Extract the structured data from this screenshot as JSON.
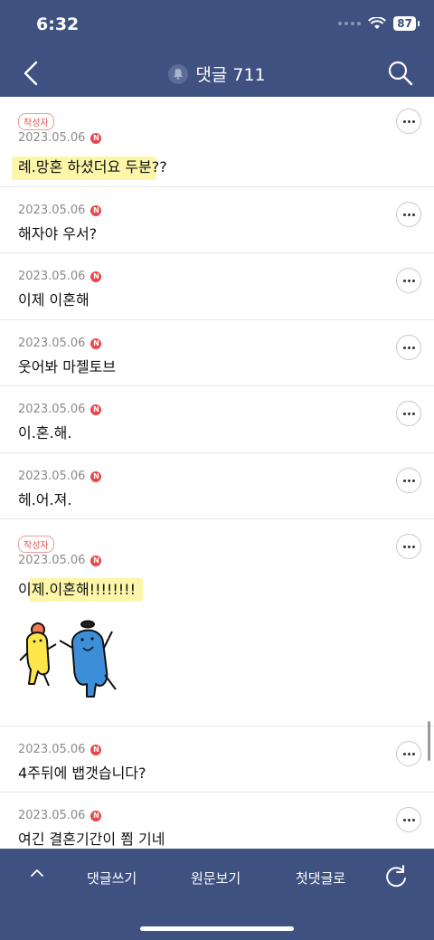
{
  "status": {
    "time": "6:32",
    "battery": "87"
  },
  "header": {
    "title": "댓글 711"
  },
  "comments": [
    {
      "author_badge": "작성자",
      "date": "2023.05.06",
      "text": "례.망혼 하셨더요 두분??"
    },
    {
      "date": "2023.05.06",
      "text": "해자야 우서?"
    },
    {
      "date": "2023.05.06",
      "text": "이제 이혼해"
    },
    {
      "date": "2023.05.06",
      "text": "웃어봐 마젤토브"
    },
    {
      "date": "2023.05.06",
      "text": "이.혼.해."
    },
    {
      "date": "2023.05.06",
      "text": "헤.어.져."
    },
    {
      "author_badge": "작성자",
      "date": "2023.05.06",
      "text": "이제.이혼해!!!!!!!!",
      "sticker": "dancing-characters-sticker"
    },
    {
      "date": "2023.05.06",
      "text": "4주뒤에 뱁갯습니다?"
    },
    {
      "date": "2023.05.06",
      "text": "여긴 결혼기간이 쬠 기네"
    }
  ],
  "n_icon_label": "N",
  "footer": {
    "write": "댓글쓰기",
    "original": "원문보기",
    "first": "첫댓글로"
  },
  "colors": {
    "header_bg": "#3e5180",
    "highlight": "#fdf6a8",
    "badge_red": "#e15656"
  }
}
